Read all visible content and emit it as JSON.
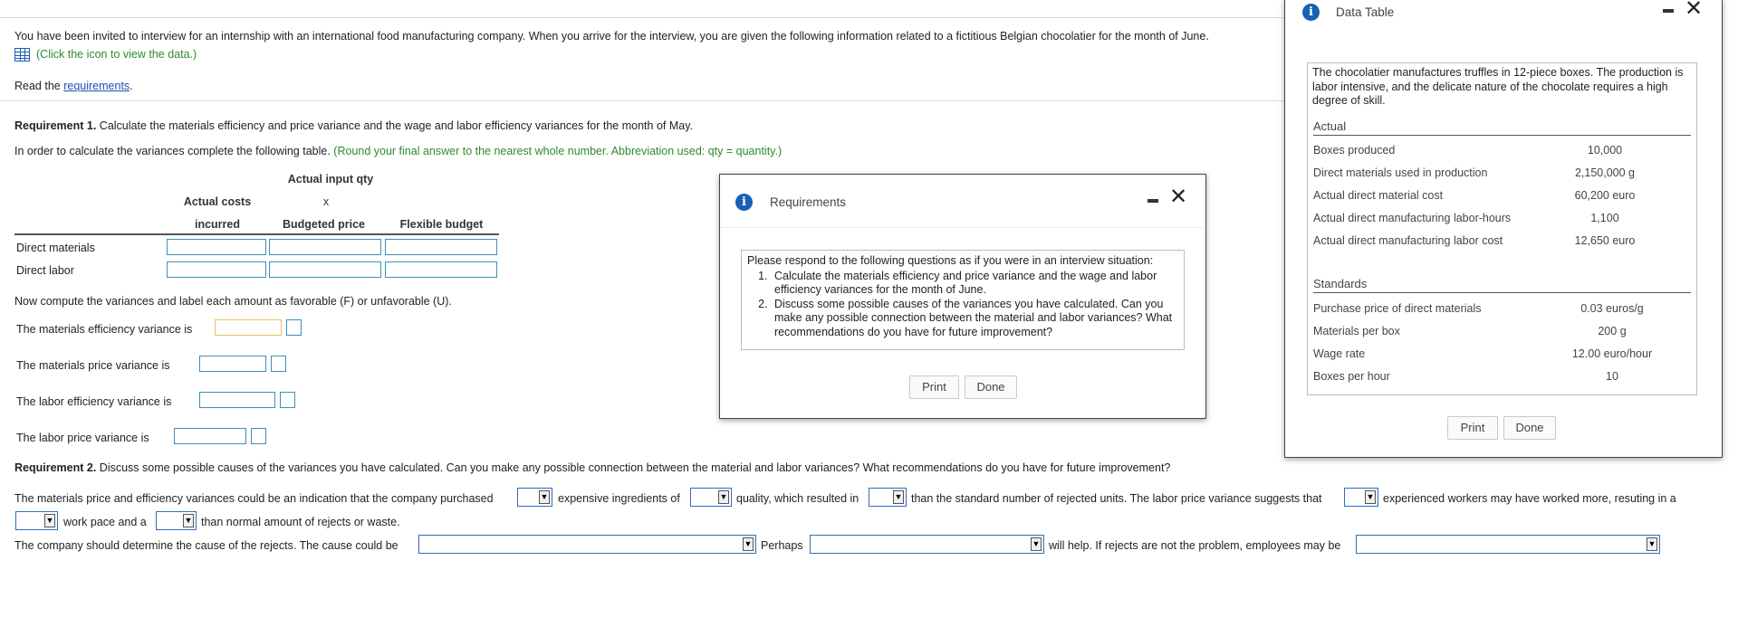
{
  "intro": {
    "text": "You have been invited to interview for an internship with an international food manufacturing company. When you arrive for the interview, you are given the following information related to a fictitious Belgian chocolatier for the month of June.",
    "data_link": "(Click the icon to view the data.)",
    "read_prefix": "Read the ",
    "read_link": "requirements",
    "read_suffix": "."
  },
  "req1": {
    "label": "Requirement 1.",
    "text": " Calculate the materials efficiency and price variance and the wage and labor efficiency variances for the month of May.",
    "instruction": "In order to calculate the variances complete the following table.",
    "instruction_note": " (Round your final answer to the nearest whole number. Abbreviation used: qty = quantity.)"
  },
  "table": {
    "header_actual_input_qty": "Actual input qty",
    "header_actual_costs": "Actual costs",
    "header_x": "x",
    "header_incurred": "incurred",
    "header_budgeted_price": "Budgeted price",
    "header_flexible_budget": "Flexible budget",
    "rows": [
      "Direct materials",
      "Direct labor"
    ]
  },
  "variances": {
    "intro": "Now compute the variances and label each amount as favorable (F) or unfavorable (U).",
    "materials_efficiency": "The materials efficiency variance is",
    "materials_price": "The materials price variance is",
    "labor_efficiency": "The labor efficiency variance is",
    "labor_price": "The labor price variance is"
  },
  "req2": {
    "label": "Requirement 2.",
    "text": " Discuss some possible causes of the variances you have calculated. Can you make any possible connection between the material and labor variances? What recommendations do you have for future improvement?",
    "s1": "The materials price and efficiency variances could be an indication that the company purchased",
    "s2": "expensive ingredients of",
    "s3": "quality, which resulted in",
    "s4": "than the standard number of rejected units. The labor price variance suggests that",
    "s5": "experienced workers may have worked more, resuting in a",
    "s6": "work pace and a",
    "s7": "than normal amount of rejects or waste.",
    "s8": "The company should determine the cause of the rejects. The cause could be",
    "s9": "Perhaps",
    "s10": "will help. If rejects are not the problem, employees may be"
  },
  "requirements_dialog": {
    "title": "Requirements",
    "intro": "Please respond to the following questions as if you were in an interview situation:",
    "items": [
      "Calculate the materials efficiency and price variance and the wage and labor efficiency variances for the month of June.",
      "Discuss some possible causes of the variances you have calculated. Can you make any possible connection between the material and labor variances? What recommendations do you have for future improvement?"
    ],
    "print": "Print",
    "done": "Done"
  },
  "data_dialog": {
    "title": "Data Table",
    "description": "The chocolatier manufactures truffles in 12-piece boxes. The production is labor intensive, and the delicate nature of the chocolate requires a high degree of skill.",
    "actual_header": "Actual",
    "actual": [
      {
        "label": "Boxes produced",
        "value": "10,000"
      },
      {
        "label": "Direct materials used in production",
        "value": "2,150,000 g"
      },
      {
        "label": "Actual direct material cost",
        "value": "60,200 euro"
      },
      {
        "label": "Actual direct manufacturing labor-hours",
        "value": "1,100"
      },
      {
        "label": "Actual direct manufacturing labor cost",
        "value": "12,650 euro"
      }
    ],
    "standards_header": "Standards",
    "standards": [
      {
        "label": "Purchase price of direct materials",
        "value": "0.03 euros/g"
      },
      {
        "label": "Materials per box",
        "value": "200 g"
      },
      {
        "label": "Wage rate",
        "value": "12.00 euro/hour"
      },
      {
        "label": "Boxes per hour",
        "value": "10"
      }
    ],
    "print": "Print",
    "done": "Done"
  },
  "colors": {
    "accent_blue": "#1a5fb4",
    "input_border": "#3d8fb8",
    "highlight_input": "#e8c060",
    "note_green": "#2e8b2e"
  }
}
